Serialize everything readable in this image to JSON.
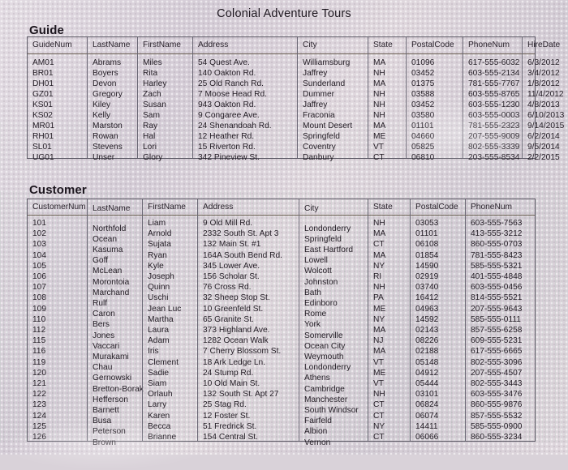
{
  "document": {
    "title": "Colonial Adventure Tours"
  },
  "guide": {
    "section_label": "Guide",
    "columns": [
      "GuideNum",
      "LastName",
      "FirstName",
      "Address",
      "City",
      "State",
      "PostalCode",
      "PhoneNum",
      "HireDate"
    ],
    "rows": [
      [
        "AM01",
        "Abrams",
        "Miles",
        "54 Quest Ave.",
        "Williamsburg",
        "MA",
        "01096",
        "617-555-6032",
        "6/3/2012"
      ],
      [
        "BR01",
        "Boyers",
        "Rita",
        "140 Oakton Rd.",
        "Jaffrey",
        "NH",
        "03452",
        "603-555-2134",
        "3/4/2012"
      ],
      [
        "DH01",
        "Devon",
        "Harley",
        "25 Old Ranch Rd.",
        "Sunderland",
        "MA",
        "01375",
        "781-555-7767",
        "1/8/2012"
      ],
      [
        "GZ01",
        "Gregory",
        "Zach",
        "7 Moose Head Rd.",
        "Dummer",
        "NH",
        "03588",
        "603-555-8765",
        "11/4/2012"
      ],
      [
        "KS01",
        "Kiley",
        "Susan",
        "943 Oakton Rd.",
        "Jaffrey",
        "NH",
        "03452",
        "603-555-1230",
        "4/8/2013"
      ],
      [
        "KS02",
        "Kelly",
        "Sam",
        "9 Congaree Ave.",
        "Fraconia",
        "NH",
        "03580",
        "603-555-0003",
        "6/10/2013"
      ],
      [
        "MR01",
        "Marston",
        "Ray",
        "24 Shenandoah Rd.",
        "Mount Desert",
        "MA",
        "01101",
        "781-555-2323",
        "9/14/2015"
      ],
      [
        "RH01",
        "Rowan",
        "Hal",
        "12 Heather Rd.",
        "Springfeld",
        "ME",
        "04660",
        "207-555-9009",
        "6/2/2014"
      ],
      [
        "SL01",
        "Stevens",
        "Lori",
        "15 Riverton Rd.",
        "Coventry",
        "VT",
        "05825",
        "802-555-3339",
        "9/5/2014"
      ],
      [
        "UG01",
        "Unser",
        "Glory",
        "342 Pineview St.",
        "Danbury",
        "CT",
        "06810",
        "203-555-8534",
        "2/2/2015"
      ]
    ]
  },
  "customer": {
    "section_label": "Customer",
    "columns": [
      "CustomerNum",
      "LastName",
      "FirstName",
      "Address",
      "City",
      "State",
      "PostalCode",
      "PhoneNum"
    ],
    "rows": [
      [
        "101",
        "Northfold",
        "Liam",
        "9 Old Mill Rd.",
        "Londonderry",
        "NH",
        "03053",
        "603-555-7563"
      ],
      [
        "102",
        "Ocean",
        "Arnold",
        "2332 South St. Apt 3",
        "Springfeld",
        "MA",
        "01101",
        "413-555-3212"
      ],
      [
        "103",
        "Kasuma",
        "Sujata",
        "132 Main St. #1",
        "East Hartford",
        "CT",
        "06108",
        "860-555-0703"
      ],
      [
        "104",
        "Goff",
        "Ryan",
        "164A South Bend Rd.",
        "Lowell",
        "MA",
        "01854",
        "781-555-8423"
      ],
      [
        "105",
        "McLean",
        "Kyle",
        "345 Lower Ave.",
        "Wolcott",
        "NY",
        "14590",
        "585-555-5321"
      ],
      [
        "106",
        "Morontoia",
        "Joseph",
        "156 Scholar St.",
        "Johnston",
        "RI",
        "02919",
        "401-555-4848"
      ],
      [
        "107",
        "Marchand",
        "Quinn",
        "76 Cross Rd.",
        "Bath",
        "NH",
        "03740",
        "603-555-0456"
      ],
      [
        "108",
        "Rulf",
        "Uschi",
        "32 Sheep Stop St.",
        "Edinboro",
        "PA",
        "16412",
        "814-555-5521"
      ],
      [
        "109",
        "Caron",
        "Jean Luc",
        "10 Greenfeld St.",
        "Rome",
        "ME",
        "04963",
        "207-555-9643"
      ],
      [
        "110",
        "Bers",
        "Martha",
        "65 Granite St.",
        "York",
        "NY",
        "14592",
        "585-555-0111"
      ],
      [
        "112",
        "Jones",
        "Laura",
        "373 Highland Ave.",
        "Somerville",
        "MA",
        "02143",
        "857-555-6258"
      ],
      [
        "115",
        "Vaccari",
        "Adam",
        "1282 Ocean Walk",
        "Ocean City",
        "NJ",
        "08226",
        "609-555-5231"
      ],
      [
        "116",
        "Murakami",
        "Iris",
        "7 Cherry Blossom St.",
        "Weymouth",
        "MA",
        "02188",
        "617-555-6665"
      ],
      [
        "119",
        "Chau",
        "Clement",
        "18 Ark Ledge Ln.",
        "Londonderry",
        "VT",
        "05148",
        "802-555-3096"
      ],
      [
        "120",
        "Gernowski",
        "Sadie",
        "24 Stump Rd.",
        "Athens",
        "ME",
        "04912",
        "207-555-4507"
      ],
      [
        "121",
        "Bretton-Borak",
        "Siam",
        "10 Old Main St.",
        "Cambridge",
        "VT",
        "05444",
        "802-555-3443"
      ],
      [
        "122",
        "Hefferson",
        "Orlauh",
        "132 South St. Apt 27",
        "Manchester",
        "NH",
        "03101",
        "603-555-3476"
      ],
      [
        "123",
        "Barnett",
        "Larry",
        "25 Stag Rd.",
        "South Windsor",
        "CT",
        "06824",
        "860-555-9876"
      ],
      [
        "124",
        "Busa",
        "Karen",
        "12 Foster St.",
        "Fairfeld",
        "CT",
        "06074",
        "857-555-5532"
      ],
      [
        "125",
        "Peterson",
        "Becca",
        "51 Fredrick St.",
        "Albion",
        "NY",
        "14411",
        "585-555-0900"
      ],
      [
        "126",
        "Brown",
        "Brianne",
        "154 Central St.",
        "Vernon",
        "CT",
        "06066",
        "860-555-3234"
      ]
    ]
  },
  "style": {
    "page_background": "#d8d1d8",
    "border_color": "#5d5a66",
    "text_color": "#221c24"
  }
}
